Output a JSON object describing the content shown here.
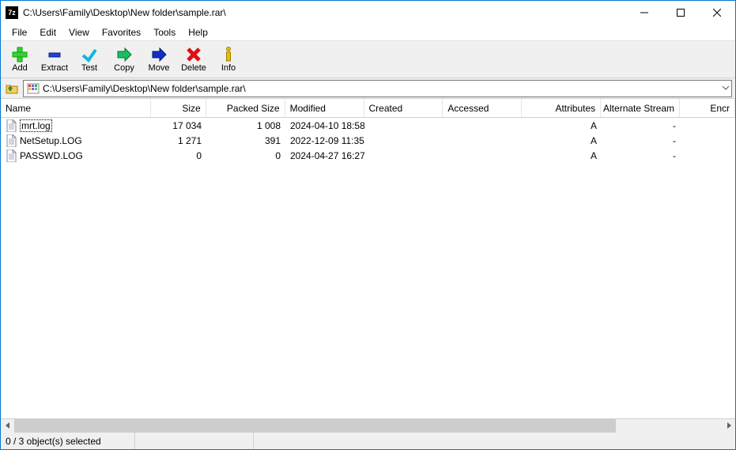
{
  "title": "C:\\Users\\Family\\Desktop\\New folder\\sample.rar\\",
  "app_icon_text": "7z",
  "menu": {
    "file": "File",
    "edit": "Edit",
    "view": "View",
    "favorites": "Favorites",
    "tools": "Tools",
    "help": "Help"
  },
  "toolbar": {
    "add": "Add",
    "extract": "Extract",
    "test": "Test",
    "copy": "Copy",
    "move": "Move",
    "delete": "Delete",
    "info": "Info"
  },
  "pathbar": {
    "path": "C:\\Users\\Family\\Desktop\\New folder\\sample.rar\\"
  },
  "columns": {
    "name": "Name",
    "size": "Size",
    "packed": "Packed Size",
    "modified": "Modified",
    "created": "Created",
    "accessed": "Accessed",
    "attributes": "Attributes",
    "altstream": "Alternate Stream",
    "encrypted": "Encr"
  },
  "rows": [
    {
      "name": "mrt.log",
      "size": "17 034",
      "packed": "1 008",
      "modified": "2024-04-10 18:58",
      "created": "",
      "accessed": "",
      "attributes": "A",
      "altstream": "-",
      "focused": true
    },
    {
      "name": "NetSetup.LOG",
      "size": "1 271",
      "packed": "391",
      "modified": "2022-12-09 11:35",
      "created": "",
      "accessed": "",
      "attributes": "A",
      "altstream": "-",
      "focused": false
    },
    {
      "name": "PASSWD.LOG",
      "size": "0",
      "packed": "0",
      "modified": "2024-04-27 16:27",
      "created": "",
      "accessed": "",
      "attributes": "A",
      "altstream": "-",
      "focused": false
    }
  ],
  "status": {
    "selection": "0 / 3 object(s) selected"
  }
}
